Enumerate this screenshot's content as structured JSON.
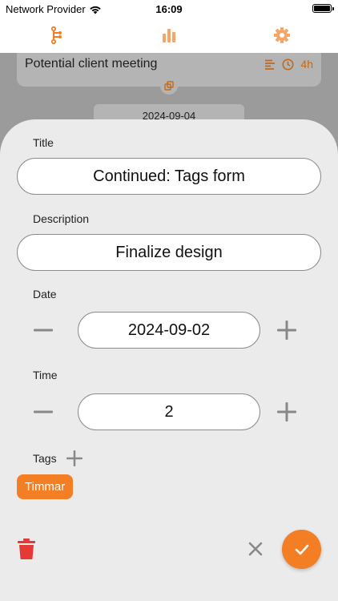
{
  "status_bar": {
    "carrier": "Network Provider",
    "time": "16:09"
  },
  "top_nav": {
    "tabs": [
      {
        "icon": "git-branch-icon"
      },
      {
        "icon": "bar-chart-icon"
      },
      {
        "icon": "gear-icon"
      }
    ],
    "active_color": "#f37e24"
  },
  "background_list": {
    "card_title": "Potential client meeting",
    "card_duration": "4h",
    "date_header": "2024-09-04"
  },
  "sheet": {
    "title_label": "Title",
    "title_value": "Continued: Tags form",
    "description_label": "Description",
    "description_value": "Finalize design",
    "date_label": "Date",
    "date_value": "2024-09-02",
    "time_label": "Time",
    "time_value": "2",
    "tags_label": "Tags",
    "tags": [
      "Timmar"
    ]
  },
  "colors": {
    "accent": "#f37e24",
    "delete": "#e53935",
    "sheet_bg": "#ebebeb"
  }
}
